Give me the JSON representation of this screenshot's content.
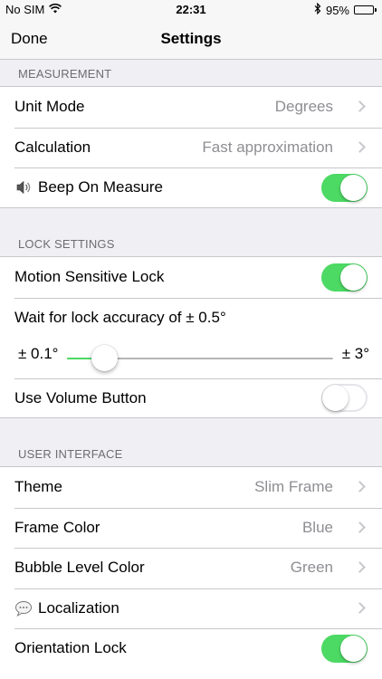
{
  "status_bar": {
    "carrier": "No SIM",
    "time": "22:31",
    "battery_percent": "95%",
    "battery_level": 0.95,
    "icons": [
      "wifi-icon",
      "bluetooth-icon",
      "battery-icon"
    ]
  },
  "nav": {
    "left_button": "Done",
    "title": "Settings"
  },
  "sections": {
    "measurement": {
      "header": "MEASUREMENT",
      "unit_mode": {
        "label": "Unit Mode",
        "value": "Degrees"
      },
      "calculation": {
        "label": "Calculation",
        "value": "Fast approximation"
      },
      "beep": {
        "label": "Beep On Measure",
        "icon": "speaker-icon",
        "enabled": true
      }
    },
    "lock_settings": {
      "header": "LOCK SETTINGS",
      "motion_lock": {
        "label": "Motion Sensitive Lock",
        "enabled": true
      },
      "accuracy": {
        "label": "Wait for lock accuracy of ± 0.5°",
        "min_label": "± 0.1°",
        "max_label": "± 3°",
        "min": 0.1,
        "max": 3,
        "value": 0.5
      },
      "volume_button": {
        "label": "Use Volume Button",
        "enabled": false
      }
    },
    "user_interface": {
      "header": "USER INTERFACE",
      "theme": {
        "label": "Theme",
        "value": "Slim Frame"
      },
      "frame_color": {
        "label": "Frame Color",
        "value": "Blue"
      },
      "bubble_color": {
        "label": "Bubble Level Color",
        "value": "Green"
      },
      "localization": {
        "label": "Localization",
        "icon": "speech-bubble-icon"
      },
      "orientation_lock": {
        "label": "Orientation Lock",
        "enabled": true
      }
    }
  },
  "colors": {
    "toggle_on": "#4cd964",
    "secondary_text": "#8e8e93",
    "section_header": "#6d6d72",
    "background": "#efeff4"
  }
}
